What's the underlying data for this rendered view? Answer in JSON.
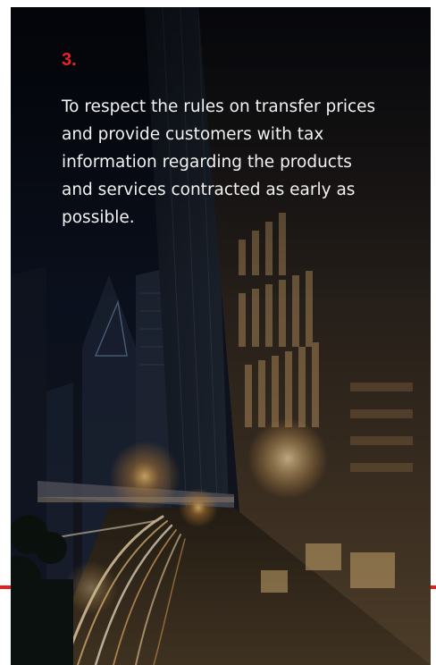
{
  "slide": {
    "number": "3.",
    "text": "To respect the rules on transfer prices and provide customers with tax information regarding the products and services contracted as early as possible."
  },
  "colors": {
    "accent": "#e8251f",
    "text": "#f2f2f2",
    "background": "#0a0d18"
  },
  "image": {
    "subject": "night-city-street-skyscrapers-light-trails"
  }
}
